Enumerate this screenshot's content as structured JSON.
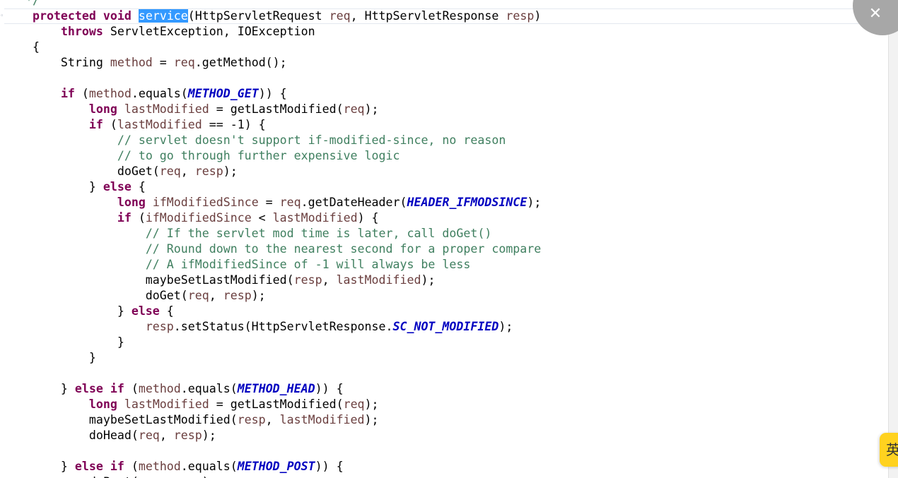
{
  "editor": {
    "language": "java",
    "selected_token": "service",
    "lines": [
      [
        {
          "t": "   */",
          "c": "cm"
        }
      ],
      [
        {
          "t": "    "
        },
        {
          "t": "protected",
          "c": "kw"
        },
        {
          "t": " "
        },
        {
          "t": "void",
          "c": "kw"
        },
        {
          "t": " "
        },
        {
          "t": "service",
          "c": "sel"
        },
        {
          "t": "(HttpServletRequest "
        },
        {
          "t": "req",
          "c": "pr"
        },
        {
          "t": ", HttpServletResponse "
        },
        {
          "t": "resp",
          "c": "pr"
        },
        {
          "t": ")"
        }
      ],
      [
        {
          "t": "        "
        },
        {
          "t": "throws",
          "c": "kw"
        },
        {
          "t": " ServletException, IOException"
        }
      ],
      [
        {
          "t": "    {"
        }
      ],
      [
        {
          "t": "        String "
        },
        {
          "t": "method",
          "c": "pr"
        },
        {
          "t": " = "
        },
        {
          "t": "req",
          "c": "pr"
        },
        {
          "t": ".getMethod();"
        }
      ],
      [
        {
          "t": ""
        }
      ],
      [
        {
          "t": "        "
        },
        {
          "t": "if",
          "c": "kw"
        },
        {
          "t": " ("
        },
        {
          "t": "method",
          "c": "pr"
        },
        {
          "t": ".equals("
        },
        {
          "t": "METHOD_GET",
          "c": "ct"
        },
        {
          "t": ")) {"
        }
      ],
      [
        {
          "t": "            "
        },
        {
          "t": "long",
          "c": "kw"
        },
        {
          "t": " "
        },
        {
          "t": "lastModified",
          "c": "pr"
        },
        {
          "t": " = getLastModified("
        },
        {
          "t": "req",
          "c": "pr"
        },
        {
          "t": ");"
        }
      ],
      [
        {
          "t": "            "
        },
        {
          "t": "if",
          "c": "kw"
        },
        {
          "t": " ("
        },
        {
          "t": "lastModified",
          "c": "pr"
        },
        {
          "t": " == -1) {"
        }
      ],
      [
        {
          "t": "                "
        },
        {
          "t": "// servlet doesn't support if-modified-since, no reason",
          "c": "cm"
        }
      ],
      [
        {
          "t": "                "
        },
        {
          "t": "// to go through further expensive logic",
          "c": "cm"
        }
      ],
      [
        {
          "t": "                doGet("
        },
        {
          "t": "req",
          "c": "pr"
        },
        {
          "t": ", "
        },
        {
          "t": "resp",
          "c": "pr"
        },
        {
          "t": ");"
        }
      ],
      [
        {
          "t": "            } "
        },
        {
          "t": "else",
          "c": "kw"
        },
        {
          "t": " {"
        }
      ],
      [
        {
          "t": "                "
        },
        {
          "t": "long",
          "c": "kw"
        },
        {
          "t": " "
        },
        {
          "t": "ifModifiedSince",
          "c": "pr"
        },
        {
          "t": " = "
        },
        {
          "t": "req",
          "c": "pr"
        },
        {
          "t": ".getDateHeader("
        },
        {
          "t": "HEADER_IFMODSINCE",
          "c": "ct"
        },
        {
          "t": ");"
        }
      ],
      [
        {
          "t": "                "
        },
        {
          "t": "if",
          "c": "kw"
        },
        {
          "t": " ("
        },
        {
          "t": "ifModifiedSince",
          "c": "pr"
        },
        {
          "t": " < "
        },
        {
          "t": "lastModified",
          "c": "pr"
        },
        {
          "t": ") {"
        }
      ],
      [
        {
          "t": "                    "
        },
        {
          "t": "// If the servlet mod time is later, call doGet()",
          "c": "cm"
        }
      ],
      [
        {
          "t": "                    "
        },
        {
          "t": "// Round down to the nearest second for a proper compare",
          "c": "cm"
        }
      ],
      [
        {
          "t": "                    "
        },
        {
          "t": "// A ifModifiedSince of -1 will always be less",
          "c": "cm"
        }
      ],
      [
        {
          "t": "                    maybeSetLastModified("
        },
        {
          "t": "resp",
          "c": "pr"
        },
        {
          "t": ", "
        },
        {
          "t": "lastModified",
          "c": "pr"
        },
        {
          "t": ");"
        }
      ],
      [
        {
          "t": "                    doGet("
        },
        {
          "t": "req",
          "c": "pr"
        },
        {
          "t": ", "
        },
        {
          "t": "resp",
          "c": "pr"
        },
        {
          "t": ");"
        }
      ],
      [
        {
          "t": "                } "
        },
        {
          "t": "else",
          "c": "kw"
        },
        {
          "t": " {"
        }
      ],
      [
        {
          "t": "                    "
        },
        {
          "t": "resp",
          "c": "pr"
        },
        {
          "t": ".setStatus(HttpServletResponse."
        },
        {
          "t": "SC_NOT_MODIFIED",
          "c": "ct"
        },
        {
          "t": ");"
        }
      ],
      [
        {
          "t": "                }"
        }
      ],
      [
        {
          "t": "            }"
        }
      ],
      [
        {
          "t": ""
        }
      ],
      [
        {
          "t": "        } "
        },
        {
          "t": "else",
          "c": "kw"
        },
        {
          "t": " "
        },
        {
          "t": "if",
          "c": "kw"
        },
        {
          "t": " ("
        },
        {
          "t": "method",
          "c": "pr"
        },
        {
          "t": ".equals("
        },
        {
          "t": "METHOD_HEAD",
          "c": "ct"
        },
        {
          "t": ")) {"
        }
      ],
      [
        {
          "t": "            "
        },
        {
          "t": "long",
          "c": "kw"
        },
        {
          "t": " "
        },
        {
          "t": "lastModified",
          "c": "pr"
        },
        {
          "t": " = getLastModified("
        },
        {
          "t": "req",
          "c": "pr"
        },
        {
          "t": ");"
        }
      ],
      [
        {
          "t": "            maybeSetLastModified("
        },
        {
          "t": "resp",
          "c": "pr"
        },
        {
          "t": ", "
        },
        {
          "t": "lastModified",
          "c": "pr"
        },
        {
          "t": ");"
        }
      ],
      [
        {
          "t": "            doHead("
        },
        {
          "t": "req",
          "c": "pr"
        },
        {
          "t": ", "
        },
        {
          "t": "resp",
          "c": "pr"
        },
        {
          "t": ");"
        }
      ],
      [
        {
          "t": ""
        }
      ],
      [
        {
          "t": "        } "
        },
        {
          "t": "else",
          "c": "kw"
        },
        {
          "t": " "
        },
        {
          "t": "if",
          "c": "kw"
        },
        {
          "t": " ("
        },
        {
          "t": "method",
          "c": "pr"
        },
        {
          "t": ".equals("
        },
        {
          "t": "METHOD_POST",
          "c": "ct"
        },
        {
          "t": ")) {"
        }
      ],
      [
        {
          "t": "            doPost("
        },
        {
          "t": "req",
          "c": "pr"
        },
        {
          "t": ", "
        },
        {
          "t": "resp",
          "c": "pr"
        },
        {
          "t": ");"
        }
      ]
    ]
  },
  "overlay": {
    "close_icon": "close-icon",
    "close_glyph": "✕",
    "ime_indicator": "英"
  },
  "colors": {
    "keyword": "#7f0055",
    "parameter_or_local": "#6a3e3e",
    "comment": "#3f7f5f",
    "constant": "#0000c0",
    "selection": "#3399ff",
    "ime_background": "#ffd21f"
  }
}
